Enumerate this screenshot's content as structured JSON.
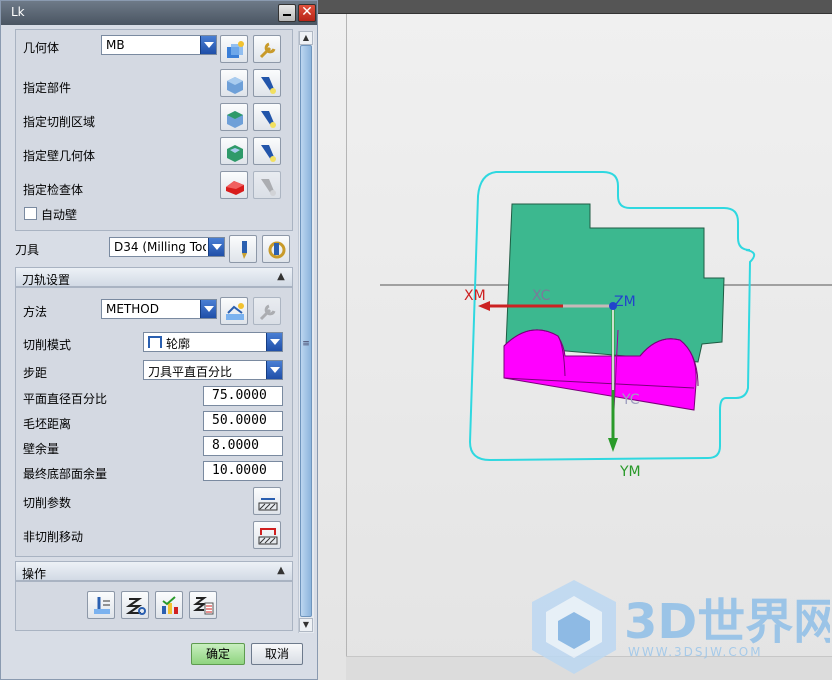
{
  "window": {
    "title": "Lk"
  },
  "geometry": {
    "geometry_label": "几何体",
    "geometry_value": "MB",
    "part_label": "指定部件",
    "cut_area_label": "指定切削区域",
    "wall_label": "指定壁几何体",
    "check_label": "指定检查体",
    "auto_wall_label": "自动壁",
    "auto_wall_checked": false
  },
  "tool": {
    "label": "刀具",
    "value": "D34 (Milling Too"
  },
  "path_settings": {
    "header": "刀轨设置",
    "method_label": "方法",
    "method_value": "METHOD",
    "cut_pattern_label": "切削模式",
    "cut_pattern_value": "轮廓",
    "stepover_label": "步距",
    "stepover_value": "刀具平直百分比",
    "flat_diameter_label": "平面直径百分比",
    "flat_diameter_value": "75.0000",
    "blank_distance_label": "毛坯距离",
    "blank_distance_value": "50.0000",
    "wall_stock_label": "壁余量",
    "wall_stock_value": "8.0000",
    "final_floor_label": "最终底部面余量",
    "final_floor_value": "10.0000",
    "cut_params_label": "切削参数",
    "noncut_moves_label": "非切削移动"
  },
  "operations": {
    "header": "操作"
  },
  "buttons": {
    "ok": "确定",
    "cancel": "取消"
  },
  "viewport": {
    "axis_xm": "XM",
    "axis_xc": "XC",
    "axis_zm": "ZM",
    "axis_yc": "YC",
    "axis_ym": "YM",
    "colors": {
      "part": "#3cb88f",
      "boss": "#ff00ff",
      "boundary": "#2fd8e0",
      "x_axis": "#cc2222",
      "y_axis": "#2a9a2a"
    }
  },
  "watermark": {
    "brand": "3D世界网",
    "url": "WWW.3DSJW.COM"
  }
}
